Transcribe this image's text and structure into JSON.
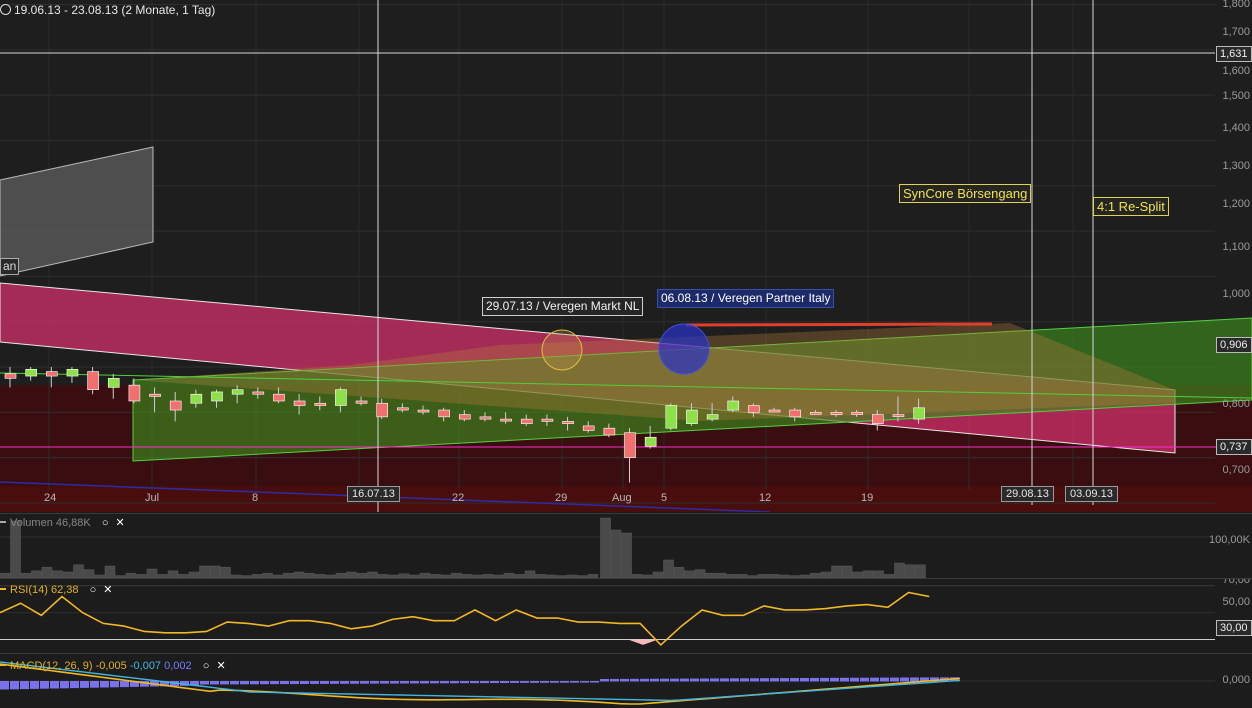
{
  "header": {
    "range_text": "19.06.13 - 23.08.13 (2 Monate, 1 Tag)"
  },
  "y_axis": {
    "ticks": [
      "1,800",
      "1,700",
      "1,600",
      "1,500",
      "1,400",
      "1,300",
      "1,200",
      "1,100",
      "1,000",
      "0,800",
      "0,700"
    ]
  },
  "price_tags": [
    "1,631",
    "0,906",
    "0,737"
  ],
  "x_axis": {
    "ticks": [
      "24",
      "Jul",
      "8",
      "22",
      "29",
      "Aug",
      "5",
      "12",
      "19"
    ]
  },
  "date_boxes": [
    "16.07.13",
    "29.08.13",
    "03.09.13"
  ],
  "annotations": {
    "left_cut_label": "an",
    "event_a": "29.07.13 / Veregen Markt NL",
    "event_b": "06.08.13 / Veregen Partner Italy",
    "syncore": "SynCore Börsengang",
    "resplit": "4:1 Re-Split"
  },
  "volume": {
    "label": "Volumen",
    "value": "46,88K",
    "axis_label": "100,00K",
    "bars": [
      8,
      95,
      8,
      12,
      18,
      12,
      10,
      22,
      14,
      5,
      20,
      4,
      8,
      6,
      15,
      6,
      12,
      6,
      10,
      20,
      20,
      18,
      5,
      4,
      6,
      8,
      5,
      8,
      10,
      8,
      6,
      5,
      8,
      10,
      8,
      10,
      6,
      5,
      7,
      5,
      8,
      6,
      5,
      8,
      6,
      5,
      6,
      5,
      8,
      6,
      12,
      6,
      5,
      4,
      5,
      4,
      6,
      100,
      80,
      75,
      6,
      5,
      10,
      30,
      18,
      12,
      14,
      8,
      8,
      6,
      6,
      4,
      6,
      6,
      5,
      4,
      5,
      8,
      10,
      20,
      20,
      10,
      12,
      12,
      6,
      25,
      22,
      22
    ]
  },
  "rsi": {
    "label": "RSI(14)",
    "value": "62,38",
    "axis_labels": [
      "70,00",
      "50,00",
      "30,00"
    ]
  },
  "macd": {
    "label": "MACD(12, 26, 9)",
    "v1": "-0,005",
    "v2": "-0,007",
    "v3": "0,002",
    "axis_label": "0,000"
  },
  "chart_data": {
    "type": "candlestick",
    "title": "",
    "x_range": [
      "19.06.13",
      "23.08.13"
    ],
    "ylim": [
      0.68,
      1.81
    ],
    "candles": [
      {
        "o": 0.975,
        "h": 1.0,
        "l": 0.955,
        "c": 0.985,
        "up": false
      },
      {
        "o": 0.98,
        "h": 1.0,
        "l": 0.97,
        "c": 0.995,
        "up": true
      },
      {
        "o": 0.99,
        "h": 1.0,
        "l": 0.955,
        "c": 0.98,
        "up": false
      },
      {
        "o": 0.98,
        "h": 1.0,
        "l": 0.965,
        "c": 0.995,
        "up": true
      },
      {
        "o": 0.99,
        "h": 1.0,
        "l": 0.94,
        "c": 0.95,
        "up": false
      },
      {
        "o": 0.955,
        "h": 0.985,
        "l": 0.93,
        "c": 0.975,
        "up": true
      },
      {
        "o": 0.96,
        "h": 0.975,
        "l": 0.92,
        "c": 0.925,
        "up": false
      },
      {
        "o": 0.94,
        "h": 0.955,
        "l": 0.9,
        "c": 0.935,
        "up": false
      },
      {
        "o": 0.925,
        "h": 0.945,
        "l": 0.88,
        "c": 0.905,
        "up": false
      },
      {
        "o": 0.92,
        "h": 0.95,
        "l": 0.91,
        "c": 0.94,
        "up": true
      },
      {
        "o": 0.925,
        "h": 0.95,
        "l": 0.91,
        "c": 0.945,
        "up": true
      },
      {
        "o": 0.94,
        "h": 0.96,
        "l": 0.92,
        "c": 0.95,
        "up": true
      },
      {
        "o": 0.945,
        "h": 0.955,
        "l": 0.93,
        "c": 0.94,
        "up": false
      },
      {
        "o": 0.94,
        "h": 0.955,
        "l": 0.92,
        "c": 0.925,
        "up": false
      },
      {
        "o": 0.925,
        "h": 0.94,
        "l": 0.895,
        "c": 0.915,
        "up": false
      },
      {
        "o": 0.915,
        "h": 0.935,
        "l": 0.905,
        "c": 0.92,
        "up": false
      },
      {
        "o": 0.915,
        "h": 0.955,
        "l": 0.9,
        "c": 0.95,
        "up": true
      },
      {
        "o": 0.925,
        "h": 0.935,
        "l": 0.915,
        "c": 0.92,
        "up": false
      },
      {
        "o": 0.92,
        "h": 0.93,
        "l": 0.885,
        "c": 0.89,
        "up": false
      },
      {
        "o": 0.91,
        "h": 0.92,
        "l": 0.9,
        "c": 0.905,
        "up": false
      },
      {
        "o": 0.905,
        "h": 0.915,
        "l": 0.895,
        "c": 0.905,
        "up": false
      },
      {
        "o": 0.905,
        "h": 0.91,
        "l": 0.88,
        "c": 0.89,
        "up": false
      },
      {
        "o": 0.895,
        "h": 0.905,
        "l": 0.88,
        "c": 0.885,
        "up": false
      },
      {
        "o": 0.89,
        "h": 0.9,
        "l": 0.88,
        "c": 0.885,
        "up": false
      },
      {
        "o": 0.885,
        "h": 0.9,
        "l": 0.875,
        "c": 0.885,
        "up": false
      },
      {
        "o": 0.885,
        "h": 0.895,
        "l": 0.87,
        "c": 0.875,
        "up": false
      },
      {
        "o": 0.88,
        "h": 0.895,
        "l": 0.87,
        "c": 0.885,
        "up": false
      },
      {
        "o": 0.88,
        "h": 0.89,
        "l": 0.86,
        "c": 0.875,
        "up": false
      },
      {
        "o": 0.87,
        "h": 0.88,
        "l": 0.855,
        "c": 0.86,
        "up": false
      },
      {
        "o": 0.865,
        "h": 0.875,
        "l": 0.845,
        "c": 0.85,
        "up": false
      },
      {
        "o": 0.855,
        "h": 0.865,
        "l": 0.745,
        "c": 0.8,
        "up": false
      },
      {
        "o": 0.825,
        "h": 0.87,
        "l": 0.82,
        "c": 0.845,
        "up": true
      },
      {
        "o": 0.865,
        "h": 0.92,
        "l": 0.86,
        "c": 0.915,
        "up": true
      },
      {
        "o": 0.875,
        "h": 0.92,
        "l": 0.87,
        "c": 0.905,
        "up": true
      },
      {
        "o": 0.885,
        "h": 0.92,
        "l": 0.88,
        "c": 0.895,
        "up": true
      },
      {
        "o": 0.905,
        "h": 0.935,
        "l": 0.9,
        "c": 0.925,
        "up": true
      },
      {
        "o": 0.915,
        "h": 0.92,
        "l": 0.89,
        "c": 0.9,
        "up": false
      },
      {
        "o": 0.905,
        "h": 0.91,
        "l": 0.9,
        "c": 0.905,
        "up": false
      },
      {
        "o": 0.905,
        "h": 0.91,
        "l": 0.88,
        "c": 0.89,
        "up": false
      },
      {
        "o": 0.9,
        "h": 0.905,
        "l": 0.895,
        "c": 0.9,
        "up": false
      },
      {
        "o": 0.9,
        "h": 0.905,
        "l": 0.89,
        "c": 0.895,
        "up": false
      },
      {
        "o": 0.9,
        "h": 0.905,
        "l": 0.89,
        "c": 0.895,
        "up": false
      },
      {
        "o": 0.895,
        "h": 0.905,
        "l": 0.86,
        "c": 0.875,
        "up": false
      },
      {
        "o": 0.895,
        "h": 0.935,
        "l": 0.88,
        "c": 0.895,
        "up": false
      },
      {
        "o": 0.885,
        "h": 0.93,
        "l": 0.875,
        "c": 0.91,
        "up": true
      }
    ],
    "volume_axis_label": "100,00K",
    "rsi_levels": [
      70,
      50,
      30
    ],
    "rsi": [
      50,
      57,
      48,
      62,
      50,
      42,
      40,
      36,
      35,
      35,
      36,
      43,
      42,
      40,
      44,
      44,
      42,
      38,
      40,
      45,
      47,
      44,
      44,
      52,
      44,
      52,
      46,
      46,
      43,
      43,
      42,
      42,
      26,
      40,
      52,
      48,
      48,
      55,
      52,
      52,
      53,
      55,
      56,
      54,
      65,
      62
    ],
    "macd_zero": 0.0
  }
}
